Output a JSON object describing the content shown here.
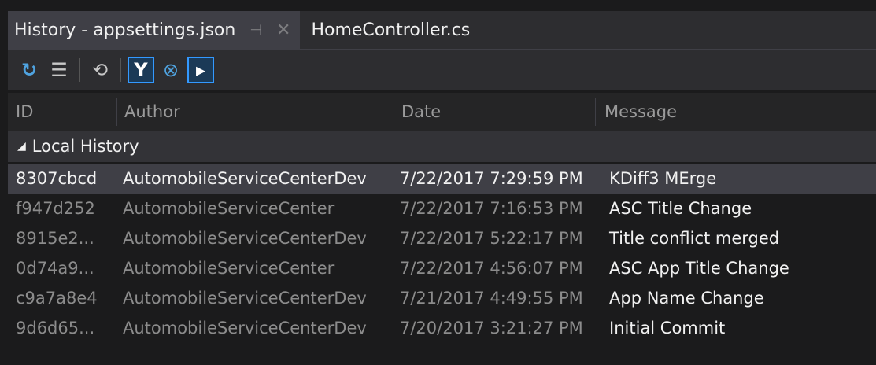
{
  "tabs": [
    {
      "label": "History - appsettings.json",
      "active": true
    },
    {
      "label": "HomeController.cs",
      "active": false
    }
  ],
  "tab_glyphs": {
    "pin": "⊣",
    "close": "✕"
  },
  "toolbar": {
    "buttons": [
      {
        "name": "refresh-icon",
        "glyph": "↻",
        "toggled": false
      },
      {
        "name": "list-view-icon",
        "glyph": "☰",
        "toggled": false
      },
      {
        "name": "history-compare-icon",
        "glyph": "⟲",
        "toggled": false
      },
      {
        "name": "branch-filter-icon",
        "glyph": "Y",
        "toggled": true
      },
      {
        "name": "merge-graph-icon",
        "glyph": "⊗",
        "toggled": false
      },
      {
        "name": "tag-icon",
        "glyph": "▸",
        "toggled": true
      }
    ]
  },
  "columns": {
    "id": "ID",
    "author": "Author",
    "date": "Date",
    "message": "Message"
  },
  "group": {
    "label": "Local History",
    "glyph": "◢"
  },
  "history": [
    {
      "id": "8307cbcd",
      "author": "AutomobileServiceCenterDev",
      "date": "7/22/2017 7:29:59 PM",
      "message": "KDiff3 MErge"
    },
    {
      "id": "f947d252",
      "author": "AutomobileServiceCenter",
      "date": "7/22/2017 7:16:53 PM",
      "message": "ASC Title Change"
    },
    {
      "id": "8915e2...",
      "author": "AutomobileServiceCenterDev",
      "date": "7/22/2017 5:22:17 PM",
      "message": "Title conflict merged"
    },
    {
      "id": "0d74a9...",
      "author": "AutomobileServiceCenter",
      "date": "7/22/2017 4:56:07 PM",
      "message": "ASC App Title Change"
    },
    {
      "id": "c9a7a8e4",
      "author": "AutomobileServiceCenterDev",
      "date": "7/21/2017 4:49:55 PM",
      "message": "App Name Change"
    },
    {
      "id": "9d6d65...",
      "author": "AutomobileServiceCenterDev",
      "date": "7/20/2017 3:21:27 PM",
      "message": "Initial Commit"
    }
  ],
  "selected_index": 0,
  "colors": {
    "selection": "#3f3f46",
    "accent": "#3399ff"
  }
}
